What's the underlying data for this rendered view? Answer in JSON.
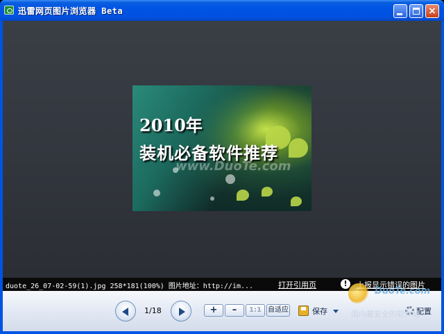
{
  "window": {
    "title": "迅雷网页图片浏览器 Beta",
    "min_label": "",
    "close_label": "×"
  },
  "image": {
    "line1": "2010年",
    "line2": "装机必备软件推荐",
    "watermark": "www.DuoTe.com"
  },
  "infobar": {
    "file_info": "duote_26_07-02-59(1).jpg 258*181(100%) 图片地址：http://im...",
    "open_link": "打开引用页",
    "warn_glyph": "!",
    "report_link": "上报显示错误的图片"
  },
  "toolbar": {
    "page_counter": "1/18",
    "zoom_in": "+",
    "zoom_out": "–",
    "actual_size": "1:1",
    "fit": "自适应",
    "save": "保存",
    "settings": "配置"
  },
  "watermark_overlay": {
    "title": "DuoTe.com",
    "subtitle": "国内最安全的软件站"
  },
  "colors": {
    "titlebar": "#0054e3",
    "viewer_bg": "#343840",
    "infobar_bg": "#0a0a0a",
    "toolbar_bg": "#e3e9f4"
  }
}
